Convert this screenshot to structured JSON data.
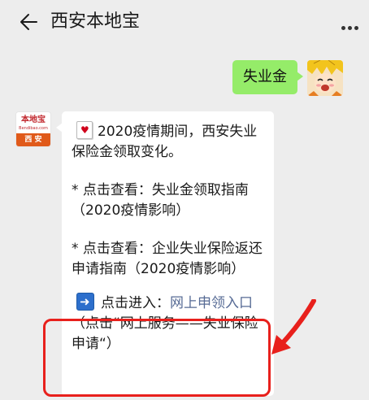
{
  "header": {
    "title": "西安本地宝",
    "back_icon": "arrow-left-icon",
    "more_icon": "more-dots-icon"
  },
  "chat": {
    "my_message": {
      "text": "失业金",
      "bubble_color": "#95ec69"
    },
    "bot_avatar": {
      "logo_name": "本地宝",
      "logo_sub": "Bendibao.com",
      "logo_city": "西 安",
      "accent_color": "#e05a1a"
    },
    "bot_message": {
      "line1_icon": "red-card-icon",
      "line1_text": "2020疫情期间，西安失业保险金领取变化。",
      "item1_prefix": "* 点击查看：",
      "item1_text": "失业金领取指南（2020疫情影响）",
      "item2_prefix": "* 点击查看：",
      "item2_text": "企业失业保险返还申请指南（2020疫情影响）",
      "entry_icon": "right-arrow-icon",
      "entry_prefix": "点击进入：",
      "entry_link": "网上申领入口",
      "entry_suffix": "（点击“网上服务——失业保险申请“）",
      "link_color": "#576b95"
    },
    "annotation": {
      "highlight_color": "#e8201c"
    }
  }
}
